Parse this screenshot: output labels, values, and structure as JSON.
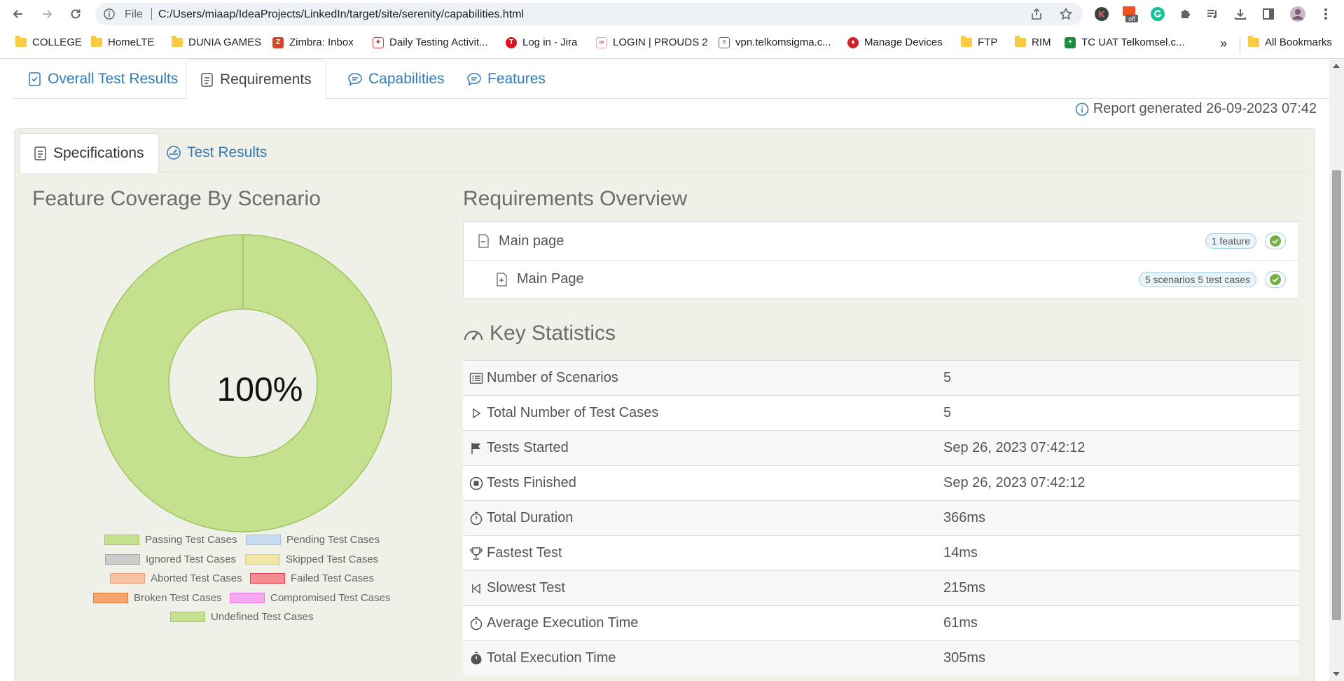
{
  "browser": {
    "omnibox": {
      "scheme_label": "File",
      "url": "C:/Users/miaap/IdeaProjects/LinkedIn/target/site/serenity/capabilities.html"
    },
    "extensions": [
      "k-extension-icon",
      "off-extension-icon",
      "grammarly-icon",
      "puzzle-icon"
    ],
    "bookmarks": [
      {
        "label": "COLLEGE",
        "icon": "folder-icon"
      },
      {
        "label": "HomeLTE",
        "icon": "folder-icon"
      },
      {
        "label": "DUNIA GAMES",
        "icon": "folder-icon"
      },
      {
        "label": "Zimbra: Inbox",
        "icon": "zimbra-icon"
      },
      {
        "label": "Daily Testing Activit...",
        "icon": "daily-testing-icon"
      },
      {
        "label": "Log in - Jira",
        "icon": "jira-icon"
      },
      {
        "label": "LOGIN | PROUDS 2",
        "icon": "prouds-icon"
      },
      {
        "label": "vpn.telkomsigma.c...",
        "icon": "document-icon"
      },
      {
        "label": "Manage Devices",
        "icon": "manage-devices-icon"
      },
      {
        "label": "FTP",
        "icon": "folder-icon"
      },
      {
        "label": "RIM",
        "icon": "folder-icon"
      },
      {
        "label": "TC UAT Telkomsel.c...",
        "icon": "sheets-icon"
      }
    ],
    "more_bookmarks": "»",
    "all_bookmarks": "All Bookmarks",
    "ext_badge": "off"
  },
  "report": {
    "main_tabs": [
      {
        "label": "Overall Test Results",
        "active": false
      },
      {
        "label": "Requirements",
        "active": true
      },
      {
        "label": "Capabilities",
        "active": false
      },
      {
        "label": "Features",
        "active": false
      }
    ],
    "generated": "Report generated 26-09-2023 07:42",
    "sub_tabs": [
      {
        "label": "Specifications",
        "active": true
      },
      {
        "label": "Test Results",
        "active": false
      }
    ],
    "coverage": {
      "title": "Feature Coverage By Scenario",
      "percent_label": "100%",
      "legend": [
        {
          "label": "Passing Test Cases",
          "fill": "#c5e08f",
          "stroke": "#9cc65a"
        },
        {
          "label": "Pending Test Cases",
          "fill": "#c6dbef",
          "stroke": "#a9c3dc"
        },
        {
          "label": "Ignored Test Cases",
          "fill": "#cccccc",
          "stroke": "#aaaaaa"
        },
        {
          "label": "Skipped Test Cases",
          "fill": "#f1e6a8",
          "stroke": "#e0d084"
        },
        {
          "label": "Aborted Test Cases",
          "fill": "#f8c4a7",
          "stroke": "#eda17d"
        },
        {
          "label": "Failed Test Cases",
          "fill": "#f58c93",
          "stroke": "#e0434f"
        },
        {
          "label": "Broken Test Cases",
          "fill": "#f7a46f",
          "stroke": "#e07d3c"
        },
        {
          "label": "Compromised Test Cases",
          "fill": "#f8a8f0",
          "stroke": "#e87ddd"
        },
        {
          "label": "Undefined Test Cases",
          "fill": "#c5e08f",
          "stroke": "#9cc65a"
        }
      ]
    },
    "requirements": {
      "title": "Requirements Overview",
      "rows": [
        {
          "label": "Main page",
          "badge": "1 feature"
        },
        {
          "label": "Main Page",
          "badge": "5 scenarios  5 test cases"
        }
      ]
    },
    "key_statistics": {
      "title": "Key Statistics",
      "rows": [
        {
          "label": "Number of Scenarios",
          "value": "5",
          "icon": "list-icon"
        },
        {
          "label": "Total Number of Test Cases",
          "value": "5",
          "icon": "play-outline-icon"
        },
        {
          "label": "Tests Started",
          "value": "Sep 26, 2023 07:42:12",
          "icon": "flag-icon"
        },
        {
          "label": "Tests Finished",
          "value": "Sep 26, 2023 07:42:12",
          "icon": "stop-circle-icon"
        },
        {
          "label": "Total Duration",
          "value": "366ms",
          "icon": "stopwatch-icon"
        },
        {
          "label": "Fastest Test",
          "value": "14ms",
          "icon": "trophy-icon"
        },
        {
          "label": "Slowest Test",
          "value": "215ms",
          "icon": "step-back-icon"
        },
        {
          "label": "Average Execution Time",
          "value": "61ms",
          "icon": "stopwatch-icon"
        },
        {
          "label": "Total Execution Time",
          "value": "305ms",
          "icon": "stopwatch-filled-icon"
        }
      ]
    }
  }
}
